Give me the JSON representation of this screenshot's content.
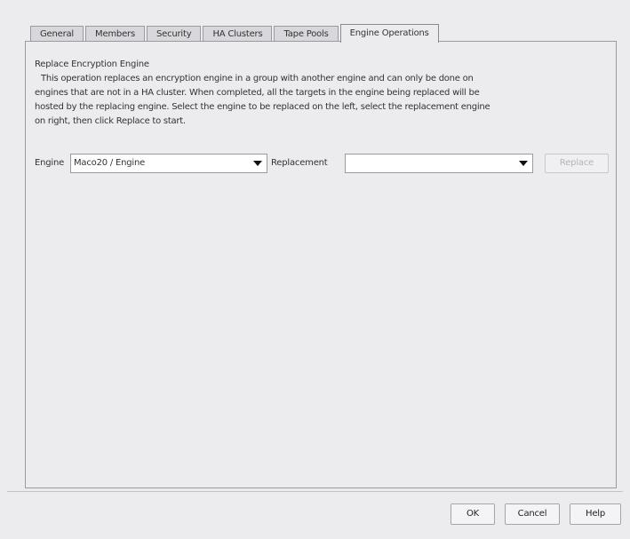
{
  "tabs": [
    {
      "label": "General",
      "active": false
    },
    {
      "label": "Members",
      "active": false
    },
    {
      "label": "Security",
      "active": false
    },
    {
      "label": "HA Clusters",
      "active": false
    },
    {
      "label": "Tape Pools",
      "active": false
    },
    {
      "label": "Engine Operations",
      "active": true
    }
  ],
  "section": {
    "title": "Replace Encryption Engine",
    "description_lines": [
      "This operation replaces an encryption engine in a group with another engine and can only be done on",
      "engines that are not in a HA cluster. When completed, all the targets in the engine being replaced will be",
      "hosted by the replacing engine. Select the engine to be replaced on the left, select the replacement engine",
      "on right, then click Replace to start."
    ]
  },
  "form": {
    "engine_label": "Engine",
    "engine_value": "Maco20 / Engine",
    "replacement_label": "Replacement",
    "replacement_value": "",
    "replace_button": "Replace",
    "replace_enabled": false
  },
  "dialog_buttons": {
    "ok": "OK",
    "cancel": "Cancel",
    "help": "Help"
  },
  "icons": {
    "dropdown": "chevron-down-icon"
  },
  "colors": {
    "background": "#ececef",
    "disabled_text": "#b4b4ba"
  }
}
